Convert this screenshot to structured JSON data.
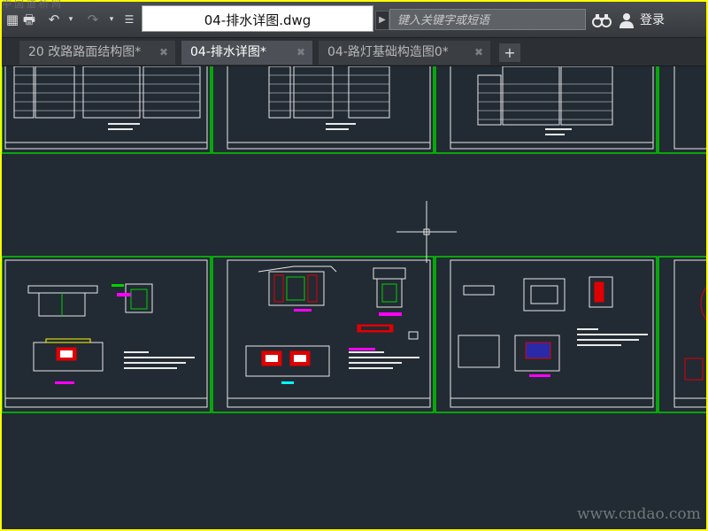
{
  "app": {
    "document_title": "04-排水详图.dwg",
    "search_placeholder": "键入关键字或短语",
    "login_label": "登录"
  },
  "tabs": [
    {
      "label": "20 改路路面结构图*",
      "active": false
    },
    {
      "label": "04-排水详图*",
      "active": true
    },
    {
      "label": "04-路灯基础构造图0*",
      "active": false
    }
  ],
  "tab_add_label": "+",
  "icons": {
    "quick_access": [
      "app-menu-icon",
      "print-icon",
      "undo-icon",
      "dropdown-icon",
      "redo-icon",
      "dropdown-icon",
      "customize-icon"
    ],
    "search_go": "search-options-icon",
    "binoculars": "binoculars-icon",
    "user": "user-icon",
    "crosshair": "crosshair-cursor"
  },
  "colors": {
    "canvas": "#222a33",
    "frame_border": "#00d000",
    "sheet_border": "#e8e8e8",
    "hatch_red": "#e00000",
    "magenta": "#ff00ff",
    "outer_border": "#ffff00"
  },
  "watermark": {
    "bottom": "www.cndao.com",
    "top": "中国道桥网"
  }
}
